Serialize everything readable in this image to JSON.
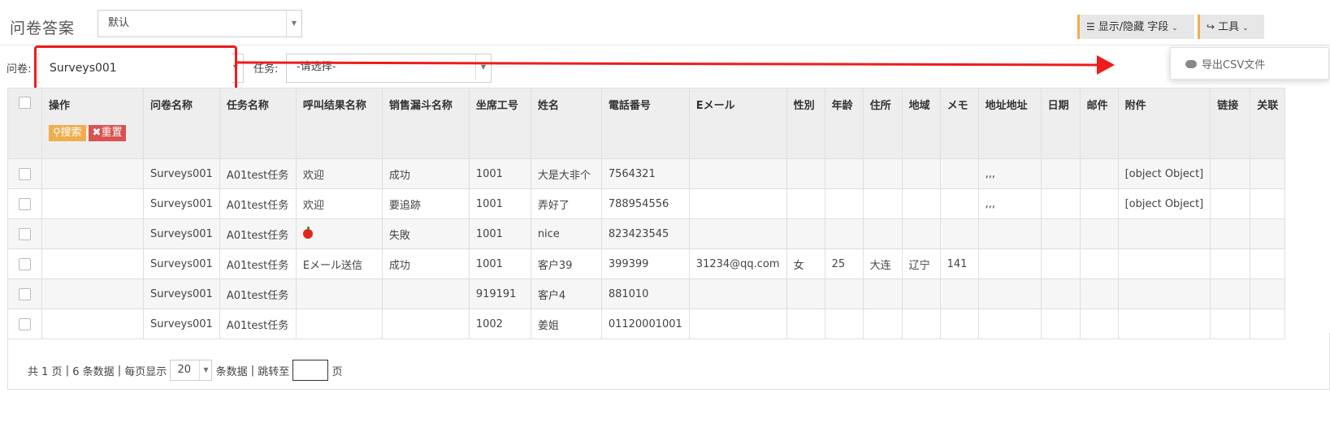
{
  "header": {
    "title": "问卷答案",
    "view_select": "默认",
    "columns_button": "显示/隐藏 字段",
    "tools_button": "工具",
    "tools_menu": [
      "导出CSV文件"
    ]
  },
  "filters": {
    "survey_label": "问卷:",
    "survey_value": "Surveys001",
    "task_label": "任务:",
    "task_placeholder": "-请选择-"
  },
  "table": {
    "columns": [
      "操作",
      "问卷名称",
      "任务名称",
      "呼叫结果名称",
      "销售漏斗名称",
      "坐席工号",
      "姓名",
      "電話番号",
      "Eメール",
      "性別",
      "年龄",
      "住所",
      "地域",
      "メモ",
      "地址地址",
      "日期",
      "邮件",
      "附件",
      "链接",
      "关联"
    ],
    "search_button": "搜索",
    "reset_button": "重置",
    "rows": [
      [
        "",
        "Surveys001",
        "A01test任务",
        "欢迎",
        "成功",
        "1001",
        "大是大非个",
        "7564321",
        "",
        "",
        "",
        "",
        "",
        "",
        ",,,",
        "",
        "",
        "[object Object]",
        "",
        ""
      ],
      [
        "",
        "Surveys001",
        "A01test任务",
        "欢迎",
        "要追跡",
        "1001",
        "弄好了",
        "788954556",
        "",
        "",
        "",
        "",
        "",
        "",
        ",,,",
        "",
        "",
        "[object Object]",
        "",
        ""
      ],
      [
        "",
        "Surveys001",
        "A01test任务",
        "",
        "失敗",
        "1001",
        "nice",
        "823423545",
        "",
        "",
        "",
        "",
        "",
        "",
        "",
        "",
        "",
        "",
        "",
        ""
      ],
      [
        "",
        "Surveys001",
        "A01test任务",
        "Eメール送信",
        "成功",
        "1001",
        "客户39",
        "399399",
        "31234@qq.com",
        "女",
        "25",
        "大连",
        "辽宁",
        "141",
        "",
        "",
        "",
        "",
        "",
        ""
      ],
      [
        "",
        "Surveys001",
        "A01test任务",
        "",
        "",
        "919191",
        "客户4",
        "881010",
        "",
        "",
        "",
        "",
        "",
        "",
        "",
        "",
        "",
        "",
        "",
        ""
      ],
      [
        "",
        "Surveys001",
        "A01test任务",
        "",
        "",
        "1002",
        "姜姐",
        "01120001001",
        "",
        "",
        "",
        "",
        "",
        "",
        "",
        "",
        "",
        "",
        "",
        ""
      ]
    ]
  },
  "pager": {
    "total_pages": "共 1 页",
    "total_rows": "6 条数据",
    "per_page_label": "每页显示",
    "per_page_value": "20",
    "rows_label": "条数据",
    "jump_label": "跳转至",
    "page_suffix": "页"
  },
  "annotation": {
    "arrow_color": "#ee1c1c"
  }
}
